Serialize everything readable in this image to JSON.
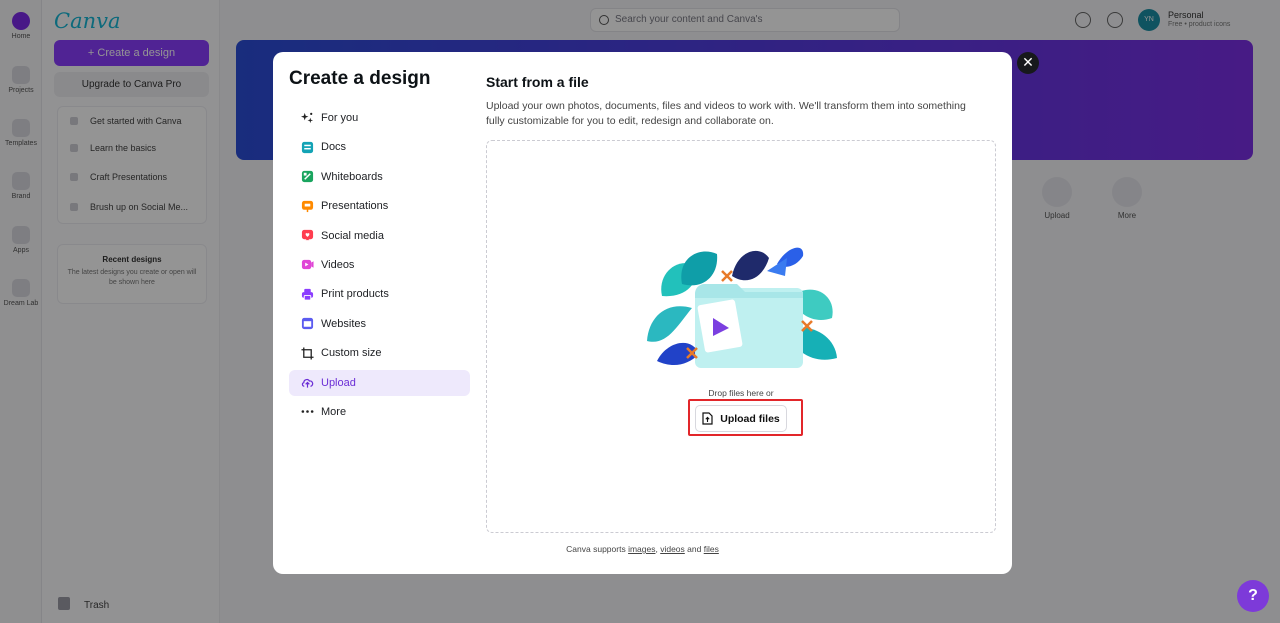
{
  "background": {
    "rail": [
      {
        "label": "Home",
        "icon": "home-icon"
      },
      {
        "label": "Projects",
        "icon": "folder-icon"
      },
      {
        "label": "Templates",
        "icon": "template-icon"
      },
      {
        "label": "Brand",
        "icon": "brand-icon"
      },
      {
        "label": "Apps",
        "icon": "apps-icon"
      },
      {
        "label": "Dream Lab",
        "icon": "dream-lab-icon"
      }
    ],
    "logo": "Canva",
    "create_button": "+ Create a design",
    "upgrade_button": "Upgrade to Canva Pro",
    "get_started": [
      "Get started with Canva",
      "Learn the basics",
      "Craft Presentations",
      "Brush up on Social Me..."
    ],
    "recent_title": "Recent designs",
    "recent_text": "The latest designs you create or open will be shown here",
    "trash": "Trash",
    "search_placeholder": "Search your content and Canva's",
    "account_name": "Personal",
    "account_plan": "Free • product icons",
    "avatar": "YN",
    "shortcuts": [
      "Upload",
      "More"
    ],
    "help": "?"
  },
  "modal": {
    "title": "Create a design",
    "close": "✕",
    "nav": [
      {
        "label": "For you",
        "icon": "sparkle-icon",
        "active": false
      },
      {
        "label": "Docs",
        "icon": "docs-icon",
        "active": false
      },
      {
        "label": "Whiteboards",
        "icon": "whiteboard-icon",
        "active": false
      },
      {
        "label": "Presentations",
        "icon": "presentation-icon",
        "active": false
      },
      {
        "label": "Social media",
        "icon": "heart-icon",
        "active": false
      },
      {
        "label": "Videos",
        "icon": "video-icon",
        "active": false
      },
      {
        "label": "Print products",
        "icon": "printer-icon",
        "active": false
      },
      {
        "label": "Websites",
        "icon": "website-icon",
        "active": false
      },
      {
        "label": "Custom size",
        "icon": "crop-icon",
        "active": false
      },
      {
        "label": "Upload",
        "icon": "cloud-upload-icon",
        "active": true
      },
      {
        "label": "More",
        "icon": "more-icon",
        "active": false
      }
    ],
    "section_title": "Start from a file",
    "section_desc": "Upload your own photos, documents, files and videos to work with. We'll transform them into something fully customizable for you to edit, redesign and collaborate on.",
    "drop_text": "Drop files here or",
    "upload_button": "Upload files",
    "supports": {
      "prefix": "Canva supports ",
      "images": "images",
      "sep": ", ",
      "videos": "videos",
      "and": " and ",
      "files": "files"
    }
  },
  "colors": {
    "brand_purple": "#8b3dff",
    "active_bg": "#eee9fc",
    "highlight": "#e2262a"
  }
}
